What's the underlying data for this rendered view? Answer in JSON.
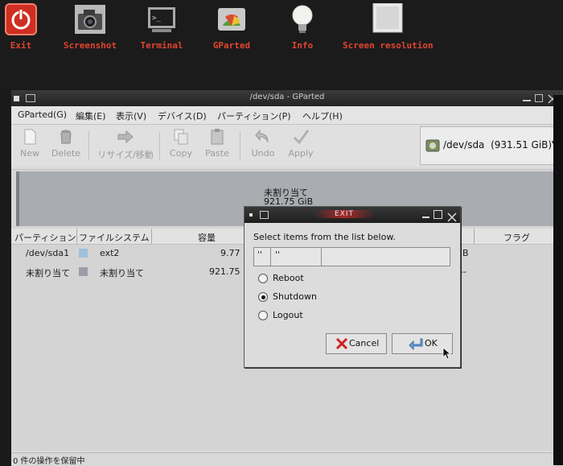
{
  "launcher": [
    {
      "id": "exit",
      "label": "Exit",
      "icon": "power-icon"
    },
    {
      "id": "screenshot",
      "label": "Screenshot",
      "icon": "camera-icon"
    },
    {
      "id": "terminal",
      "label": "Terminal",
      "icon": "terminal-icon"
    },
    {
      "id": "gparted",
      "label": "GParted",
      "icon": "gparted-icon"
    },
    {
      "id": "info",
      "label": "Info",
      "icon": "lightbulb-icon"
    },
    {
      "id": "screen_resolution",
      "label": "Screen resolution",
      "icon": "monitor-icon"
    }
  ],
  "window": {
    "title": "/dev/sda - GParted",
    "menu": [
      "GParted(G)",
      "編集(E)",
      "表示(V)",
      "デバイス(D)",
      "パーティション(P)",
      "ヘルプ(H)"
    ],
    "toolbar": {
      "new": "New",
      "delete": "Delete",
      "resize": "リサイズ/移動",
      "copy": "Copy",
      "paste": "Paste",
      "undo": "Undo",
      "apply": "Apply"
    },
    "device": {
      "path": "/dev/sda",
      "size": "(931.51 GiB)"
    },
    "graph": {
      "label": "未割り当て",
      "size": "921.75 GiB"
    },
    "columns": {
      "partition": "パーティション",
      "filesystem": "ファイルシステム",
      "capacity": "容量",
      "flags": "フラグ"
    },
    "rows": [
      {
        "partition": "/dev/sda1",
        "filesystem": "ext2",
        "capacity": "9.77",
        "fs_color": "#9ec0dc",
        "tail": "iB"
      },
      {
        "partition": "未割り当て",
        "filesystem": "未割り当て",
        "capacity": "921.75",
        "fs_color": "#9a9ea4",
        "tail": "--"
      }
    ],
    "status": "0 件の操作を保留中"
  },
  "dialog": {
    "title": "EXIT",
    "prompt": "Select items from the list below.",
    "list_headers": [
      "''",
      "''"
    ],
    "options": [
      {
        "label": "Reboot",
        "selected": false
      },
      {
        "label": "Shutdown",
        "selected": true
      },
      {
        "label": "Logout",
        "selected": false
      }
    ],
    "cancel_label": "Cancel",
    "ok_label": "OK"
  },
  "colors": {
    "launcher_label": "#e2452e",
    "desktop": "#1b1b1b",
    "titlebar": "#2a2a2a",
    "window_bg": "#dcdcdc"
  }
}
